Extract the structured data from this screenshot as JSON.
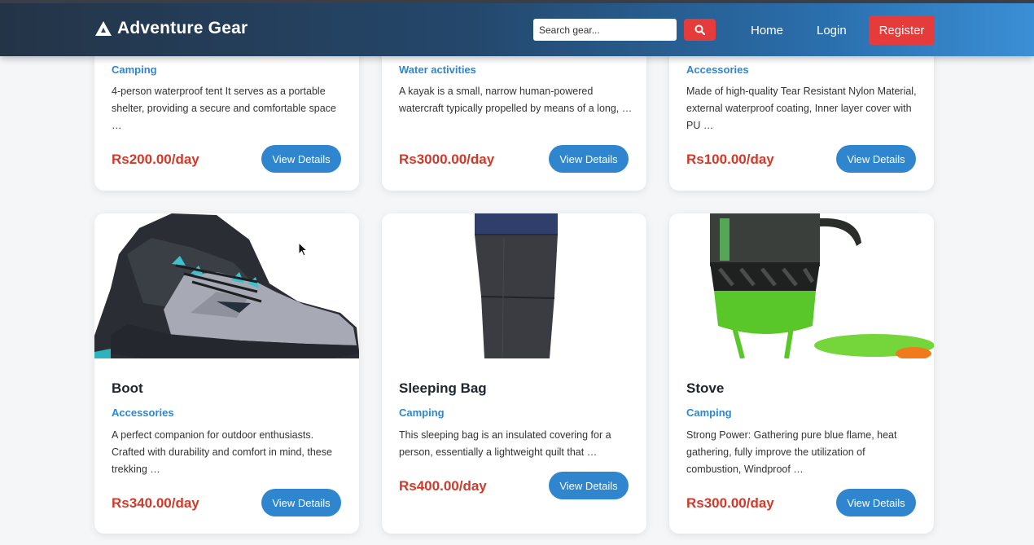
{
  "header": {
    "brand": "Adventure Gear",
    "search_placeholder": "Search gear...",
    "nav": {
      "home": "Home",
      "login": "Login",
      "register": "Register"
    }
  },
  "colors": {
    "accent": "#2f86cf",
    "danger": "#e53b3b",
    "price": "#cf3a2a"
  },
  "products_top": [
    {
      "category": "Camping",
      "description": "4-person waterproof tent It serves as a portable shelter, providing a secure and comfortable space …",
      "price": "Rs200.00/day",
      "button": "View Details"
    },
    {
      "category": "Water activities",
      "description": "A kayak is a small, narrow human-powered watercraft typically propelled by means of a long, …",
      "price": "Rs3000.00/day",
      "button": "View Details"
    },
    {
      "category": "Accessories",
      "description": "Made of high-quality Tear Resistant Nylon Material, external waterproof coating, Inner layer cover with PU …",
      "price": "Rs100.00/day",
      "button": "View Details"
    }
  ],
  "products": [
    {
      "name": "Boot",
      "category": "Accessories",
      "description": "A perfect companion for outdoor enthusiasts. Crafted with durability and comfort in mind, these trekking …",
      "price": "Rs340.00/day",
      "button": "View Details",
      "image": "boot-image"
    },
    {
      "name": "Sleeping Bag",
      "category": "Camping",
      "description": "This sleeping bag is an insulated covering for a person, essentially a lightweight quilt that …",
      "price": "Rs400.00/day",
      "button": "View Details",
      "image": "sleeping-bag-image"
    },
    {
      "name": "Stove",
      "category": "Camping",
      "description": "Strong Power: Gathering pure blue flame, heat gathering, fully improve the utilization of combustion, Windproof …",
      "price": "Rs300.00/day",
      "button": "View Details",
      "image": "stove-image"
    }
  ]
}
